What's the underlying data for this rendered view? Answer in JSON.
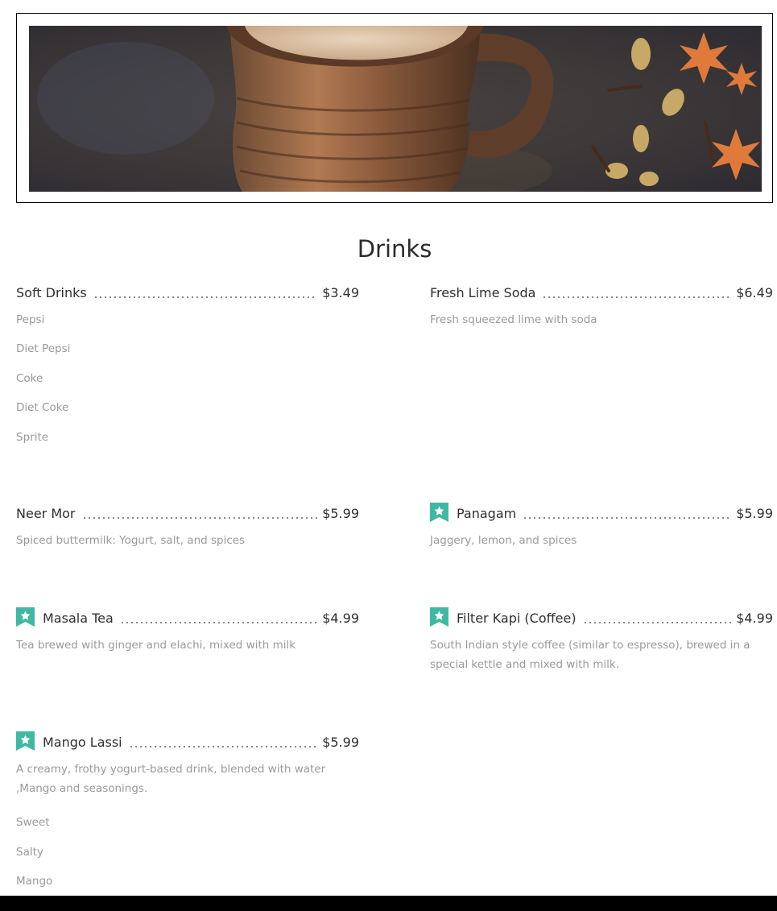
{
  "page": {
    "section_title": "Drinks"
  },
  "colors": {
    "badge": "#3fb8a4",
    "divider_dots": "#6b6b6b",
    "description": "#9a9a9a",
    "footer": "#000000"
  },
  "hero": {
    "image_subject": "masala chai cup with spices",
    "icon": "chai-photo"
  },
  "items": [
    {
      "name": "Soft Drinks",
      "price": "$3.49",
      "badge": false,
      "description": "",
      "options": [
        "Pepsi",
        "Diet Pepsi",
        "Coke",
        "Diet Coke",
        "Sprite"
      ]
    },
    {
      "name": "Fresh Lime Soda",
      "price": "$6.49",
      "badge": false,
      "description": "Fresh squeezed lime with soda",
      "options": []
    },
    {
      "name": "Neer Mor",
      "price": "$5.99",
      "badge": false,
      "description": "Spiced buttermilk: Yogurt, salt, and spices",
      "options": []
    },
    {
      "name": "Panagam",
      "price": "$5.99",
      "badge": true,
      "badge_icon": "star-ribbon-icon",
      "description": "Jaggery, lemon, and spices",
      "options": []
    },
    {
      "name": "Masala Tea",
      "price": "$4.99",
      "badge": true,
      "badge_icon": "star-ribbon-icon",
      "description": "Tea brewed with ginger and elachi, mixed with milk",
      "options": []
    },
    {
      "name": "Filter Kapi (Coffee)",
      "price": "$4.99",
      "badge": true,
      "badge_icon": "star-ribbon-icon",
      "description": "South Indian style coffee (similar to espresso), brewed in a special kettle and mixed with milk.",
      "options": []
    },
    {
      "name": "Mango Lassi",
      "price": "$5.99",
      "badge": true,
      "badge_icon": "star-ribbon-icon",
      "description": "A creamy, frothy yogurt-based drink, blended with water ,Mango and seasonings.",
      "options": [
        "Sweet",
        "Salty",
        "Mango"
      ]
    }
  ]
}
